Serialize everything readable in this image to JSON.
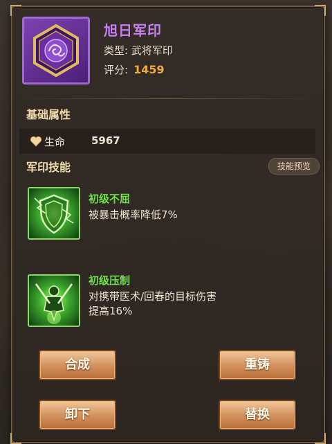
{
  "item": {
    "name": "旭日军印",
    "type_text": "类型: 武将军印",
    "score_label": "评分:",
    "score_value": "1459"
  },
  "base_attributes": {
    "title": "基础属性",
    "attrs": [
      {
        "icon": "heart-icon",
        "label": "生命",
        "value": "5967"
      }
    ]
  },
  "skills": {
    "title": "军印技能",
    "preview_label": "技能预览",
    "list": [
      {
        "icon": "shield-skill-icon",
        "name": "初级不屈",
        "desc": "被暴击概率降低7%"
      },
      {
        "icon": "warrior-skill-icon",
        "name": "初级压制",
        "desc": "对携带医术/回春的目标伤害\n提高16%"
      }
    ]
  },
  "actions": {
    "compose": "合成",
    "recast": "重铸",
    "unequip": "卸下",
    "replace": "替换"
  },
  "colors": {
    "title": "#c680f2",
    "score": "#f3a93c",
    "skill_name": "#6fe04a",
    "section": "#f1dba9"
  }
}
